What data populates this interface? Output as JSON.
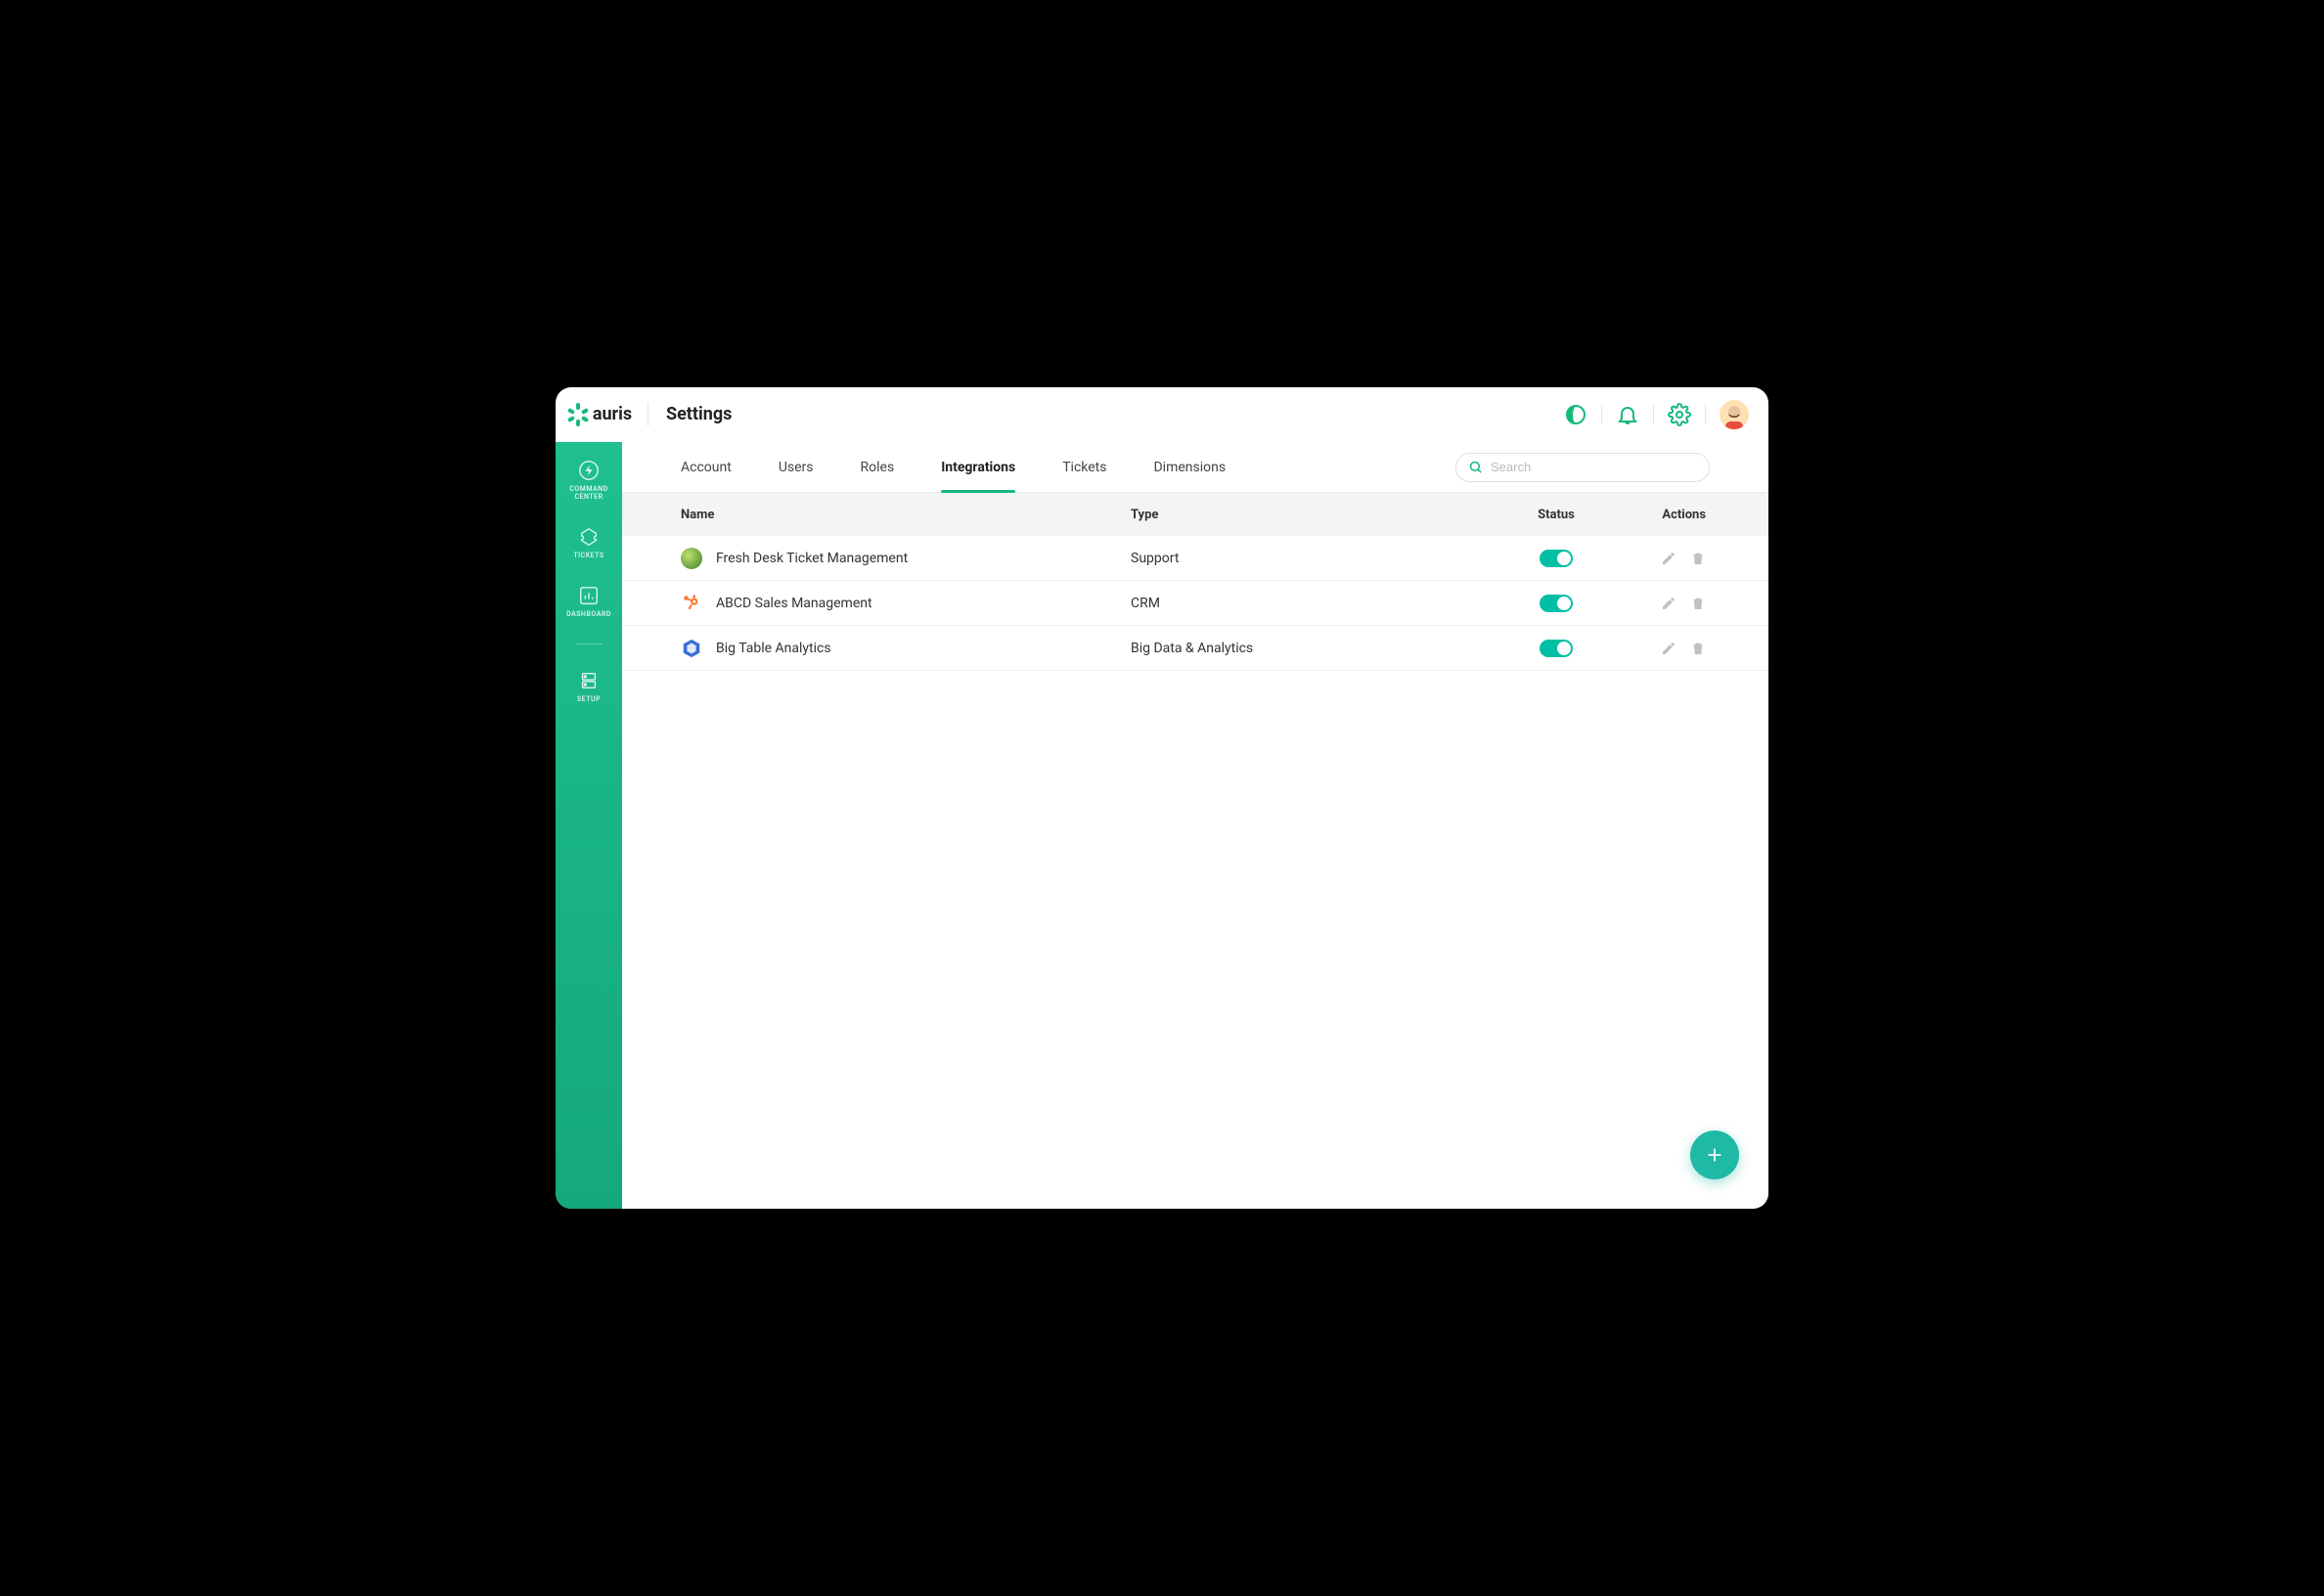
{
  "brand": {
    "name": "auris"
  },
  "header": {
    "title": "Settings"
  },
  "search": {
    "placeholder": "Search"
  },
  "sidebar": {
    "items": [
      {
        "label": "COMMAND CENTER",
        "icon": "bolt-circle-icon"
      },
      {
        "label": "TICKETS",
        "icon": "ticket-icon"
      },
      {
        "label": "DASHBOARD",
        "icon": "chart-icon"
      },
      {
        "label": "SETUP",
        "icon": "server-icon"
      }
    ]
  },
  "tabs": [
    {
      "label": "Account",
      "active": false
    },
    {
      "label": "Users",
      "active": false
    },
    {
      "label": "Roles",
      "active": false
    },
    {
      "label": "Integrations",
      "active": true
    },
    {
      "label": "Tickets",
      "active": false
    },
    {
      "label": "Dimensions",
      "active": false
    }
  ],
  "table": {
    "columns": {
      "name": "Name",
      "type": "Type",
      "status": "Status",
      "actions": "Actions"
    },
    "rows": [
      {
        "name": "Fresh Desk Ticket Management",
        "type": "Support",
        "status_on": true,
        "icon_color": "#6ab04c",
        "icon": "freshdesk"
      },
      {
        "name": "ABCD Sales Management",
        "type": "CRM",
        "status_on": true,
        "icon_color": "#ff7a33",
        "icon": "hubspot"
      },
      {
        "name": "Big Table Analytics",
        "type": "Big Data & Analytics",
        "status_on": true,
        "icon_color": "#3b6fd6",
        "icon": "bigtable"
      }
    ]
  }
}
